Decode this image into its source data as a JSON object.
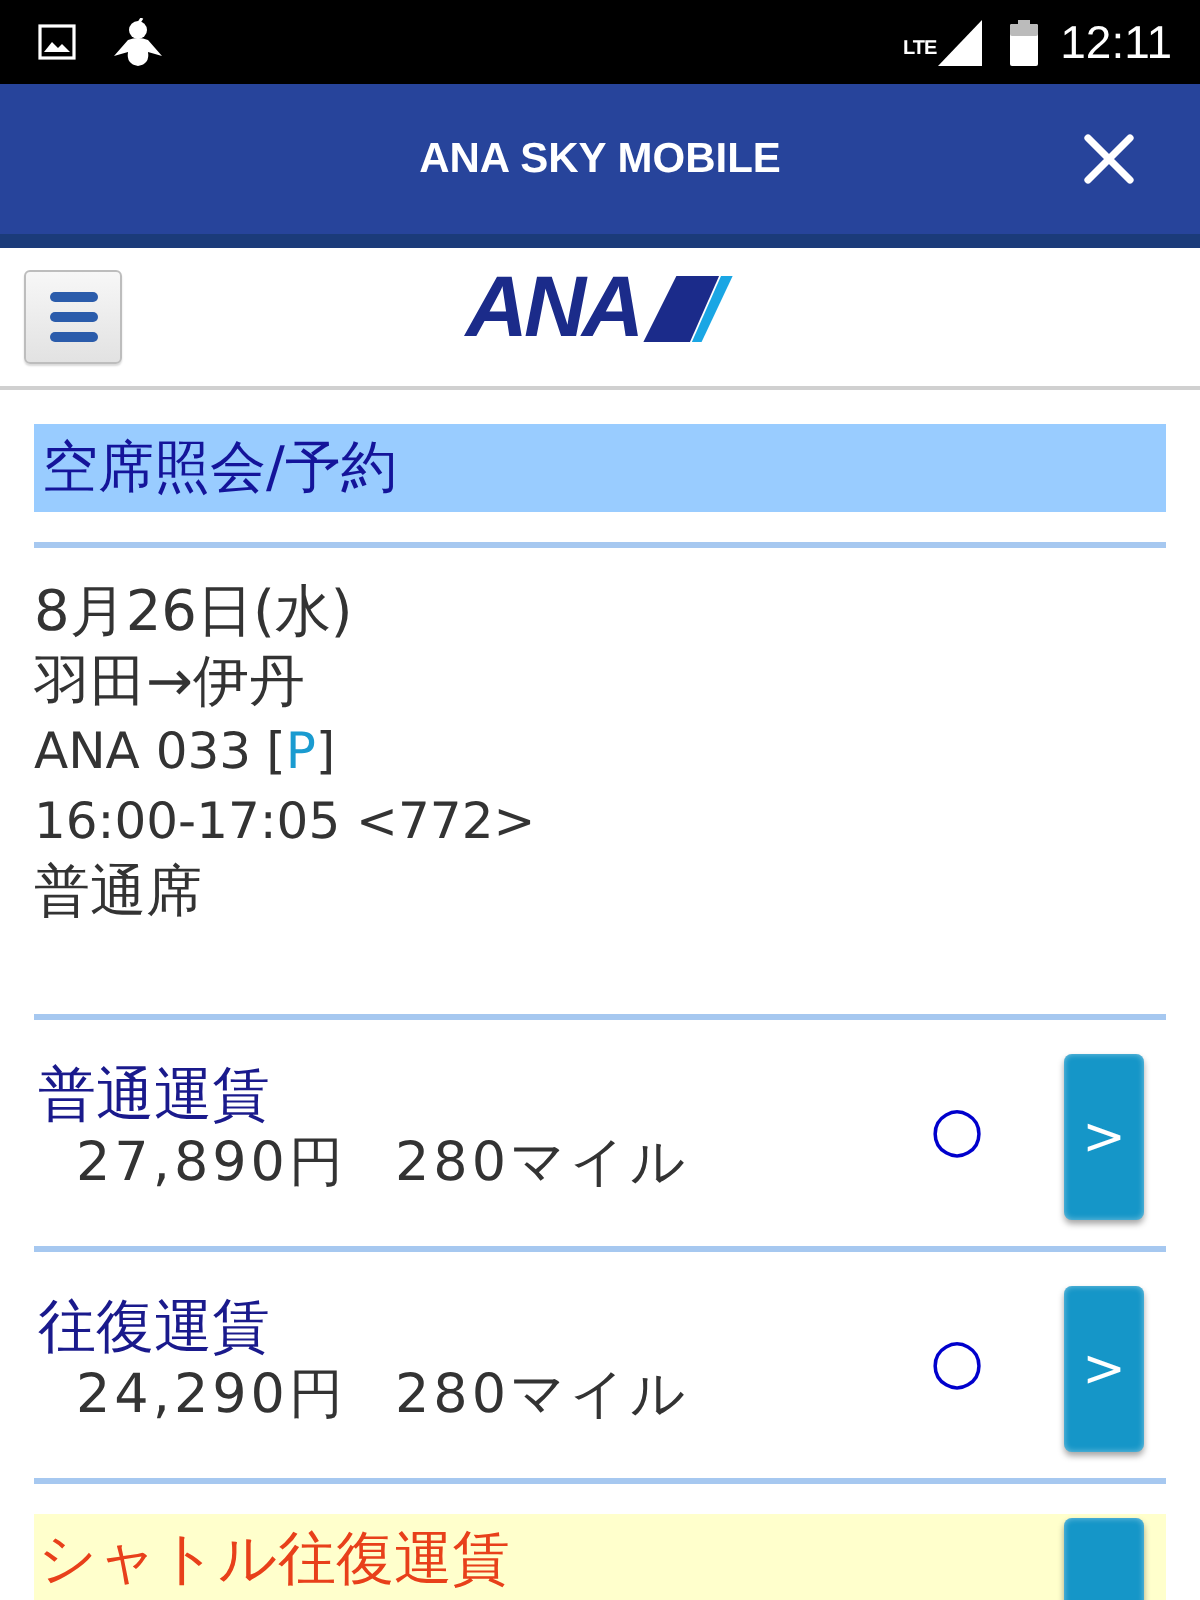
{
  "status_bar": {
    "network": "LTE",
    "time": "12:11"
  },
  "app_bar": {
    "title": "ANA SKY MOBILE"
  },
  "header": {
    "logo": "ANA"
  },
  "page_title": "空席照会/予約",
  "flight": {
    "date": "8月26日(水)",
    "route": "羽田→伊丹",
    "number": "ANA 033",
    "mark_open": "[",
    "mark": "P",
    "mark_close": "]",
    "time": "16:00-17:05 <772>",
    "seat_class": "普通席"
  },
  "fares": [
    {
      "name": "普通運賃",
      "price": "27,890円",
      "miles": "280マイル",
      "availability": "○",
      "button": ">",
      "highlighted": false
    },
    {
      "name": "往復運賃",
      "price": "24,290円",
      "miles": "280マイル",
      "availability": "○",
      "button": ">",
      "highlighted": false
    },
    {
      "name": "シャトル往復運賃",
      "highlighted": true
    }
  ]
}
